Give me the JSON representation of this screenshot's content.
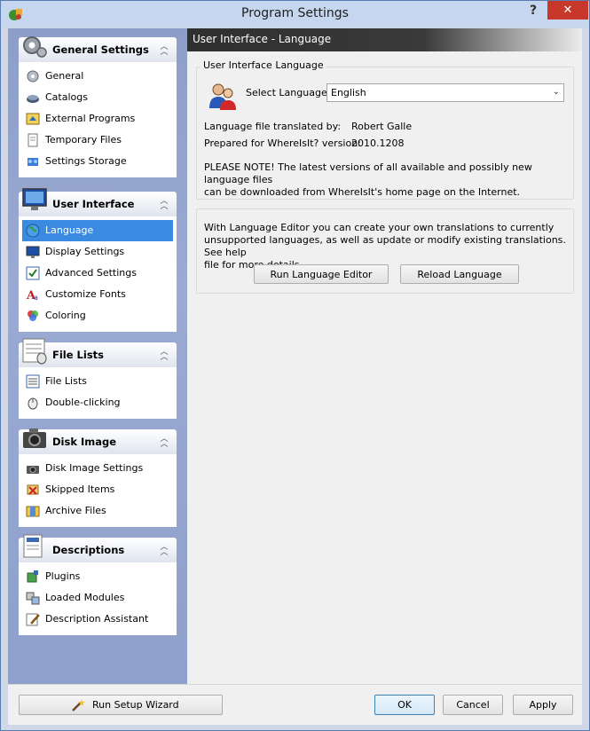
{
  "window": {
    "title": "Program Settings",
    "help_label": "?",
    "close_label": "✕"
  },
  "sidebar": {
    "groups": [
      {
        "title": "General Settings",
        "icon": "gears-icon",
        "items": [
          {
            "label": "General",
            "icon": "gear-icon"
          },
          {
            "label": "Catalogs",
            "icon": "disk-icon"
          },
          {
            "label": "External Programs",
            "icon": "programs-icon"
          },
          {
            "label": "Temporary Files",
            "icon": "document-icon"
          },
          {
            "label": "Settings Storage",
            "icon": "storage-icon"
          }
        ]
      },
      {
        "title": "User Interface",
        "icon": "monitor-icon",
        "items": [
          {
            "label": "Language",
            "icon": "globe-icon",
            "selected": true
          },
          {
            "label": "Display Settings",
            "icon": "display-icon"
          },
          {
            "label": "Advanced Settings",
            "icon": "checklist-icon"
          },
          {
            "label": "Customize Fonts",
            "icon": "font-icon"
          },
          {
            "label": "Coloring",
            "icon": "palette-icon"
          }
        ]
      },
      {
        "title": "File Lists",
        "icon": "file-list-icon",
        "items": [
          {
            "label": "File Lists",
            "icon": "list-icon"
          },
          {
            "label": "Double-clicking",
            "icon": "mouse-icon"
          }
        ]
      },
      {
        "title": "Disk Image",
        "icon": "camera-icon",
        "items": [
          {
            "label": "Disk Image Settings",
            "icon": "camera-small-icon"
          },
          {
            "label": "Skipped Items",
            "icon": "skip-icon"
          },
          {
            "label": "Archive Files",
            "icon": "archive-icon"
          }
        ]
      },
      {
        "title": "Descriptions",
        "icon": "descriptions-icon",
        "items": [
          {
            "label": "Plugins",
            "icon": "plugin-icon"
          },
          {
            "label": "Loaded Modules",
            "icon": "modules-icon"
          },
          {
            "label": "Description Assistant",
            "icon": "pencil-icon"
          }
        ]
      }
    ]
  },
  "main": {
    "header_title": "User Interface - Language",
    "lang_group": {
      "legend": "User Interface Language",
      "select_label": "Select Language:",
      "select_value": "English",
      "translated_by_label": "Language file translated by:",
      "translated_by_value": "Robert Galle",
      "prepared_label": "Prepared for WhereIsIt? version:",
      "prepared_value": "2010.1208",
      "note_line1": "PLEASE NOTE!  The latest versions of all available and possibly new language files",
      "note_line2": "can be downloaded from WhereIsIt's home page on the Internet."
    },
    "editor_group": {
      "text_line1": "With Language Editor you can create your own translations to currently",
      "text_line2": "unsupported languages, as well as update or modify existing translations. See help",
      "text_line3": "file for more details.",
      "run_editor_label": "Run Language Editor",
      "reload_label": "Reload Language"
    }
  },
  "bottom": {
    "wizard_label": "Run Setup Wizard",
    "ok_label": "OK",
    "cancel_label": "Cancel",
    "apply_label": "Apply"
  },
  "colors": {
    "selection": "#3a8ae2",
    "close_button": "#c7382b",
    "sidebar": "#95a6cf"
  }
}
